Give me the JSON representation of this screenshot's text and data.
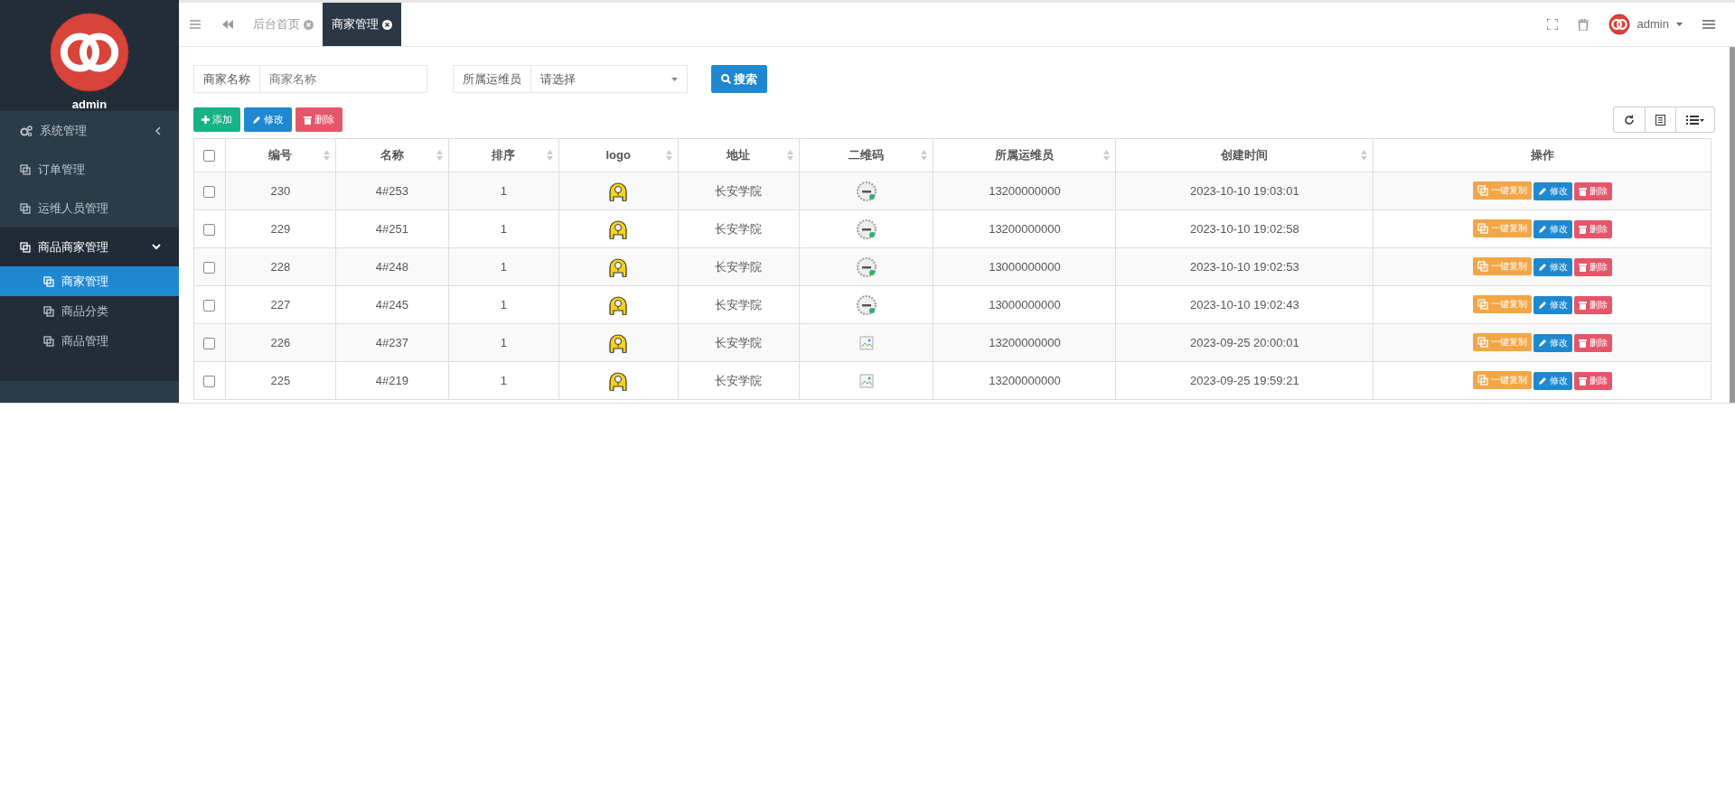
{
  "sidebar": {
    "user": "admin",
    "items": [
      {
        "label": "系统管理",
        "kind": "settings",
        "expanded": false
      },
      {
        "label": "订单管理",
        "kind": "page"
      },
      {
        "label": "运维人员管理",
        "kind": "page"
      },
      {
        "label": "商品商家管理",
        "kind": "page",
        "expanded": true,
        "children": [
          {
            "label": "商家管理",
            "selected": true
          },
          {
            "label": "商品分类",
            "selected": false
          },
          {
            "label": "商品管理",
            "selected": false
          }
        ]
      }
    ]
  },
  "tabs": [
    {
      "label": "后台首页",
      "selected": false
    },
    {
      "label": "商家管理",
      "selected": true
    }
  ],
  "header": {
    "user": "admin"
  },
  "filters": [
    {
      "kind": "text",
      "label": "商家名称",
      "placeholder": "商家名称"
    },
    {
      "kind": "select",
      "label": "所属运维员",
      "placeholder": "请选择"
    }
  ],
  "search_button": "搜索",
  "toolbar": [
    {
      "kind": "add",
      "label": "添加"
    },
    {
      "kind": "edit",
      "label": "修改"
    },
    {
      "kind": "delete",
      "label": "删除"
    }
  ],
  "table": {
    "select_all": {
      "checked": false
    },
    "columns": [
      {
        "label": "编号",
        "sortable": true
      },
      {
        "label": "名称",
        "sortable": true
      },
      {
        "label": "排序",
        "sortable": true
      },
      {
        "label": "logo",
        "sortable": true
      },
      {
        "label": "地址",
        "sortable": true
      },
      {
        "label": "二维码",
        "sortable": true
      },
      {
        "label": "所属运维员",
        "sortable": true
      },
      {
        "label": "创建时间",
        "sortable": true
      },
      {
        "label": "操作",
        "sortable": false
      }
    ],
    "rows": [
      {
        "checked": false,
        "id": "230",
        "name": "4#253",
        "order": "1",
        "address": "长安学院",
        "qr": {
          "kind": "image"
        },
        "staff": "13200000000",
        "created": "2023-10-10 19:03:01",
        "actions": [
          {
            "kind": "copy",
            "label": "一键复制"
          },
          {
            "kind": "edit",
            "label": "修改"
          },
          {
            "kind": "delete",
            "label": "删除"
          }
        ]
      },
      {
        "checked": false,
        "id": "229",
        "name": "4#251",
        "order": "1",
        "address": "长安学院",
        "qr": {
          "kind": "image"
        },
        "staff": "13200000000",
        "created": "2023-10-10 19:02:58",
        "actions": [
          {
            "kind": "copy",
            "label": "一键复制"
          },
          {
            "kind": "edit",
            "label": "修改"
          },
          {
            "kind": "delete",
            "label": "删除"
          }
        ]
      },
      {
        "checked": false,
        "id": "228",
        "name": "4#248",
        "order": "1",
        "address": "长安学院",
        "qr": {
          "kind": "image"
        },
        "staff": "13000000000",
        "created": "2023-10-10 19:02:53",
        "actions": [
          {
            "kind": "copy",
            "label": "一键复制"
          },
          {
            "kind": "edit",
            "label": "修改"
          },
          {
            "kind": "delete",
            "label": "删除"
          }
        ]
      },
      {
        "checked": false,
        "id": "227",
        "name": "4#245",
        "order": "1",
        "address": "长安学院",
        "qr": {
          "kind": "image"
        },
        "staff": "13000000000",
        "created": "2023-10-10 19:02:43",
        "actions": [
          {
            "kind": "copy",
            "label": "一键复制"
          },
          {
            "kind": "edit",
            "label": "修改"
          },
          {
            "kind": "delete",
            "label": "删除"
          }
        ]
      },
      {
        "checked": false,
        "id": "226",
        "name": "4#237",
        "order": "1",
        "address": "长安学院",
        "qr": {
          "kind": "broken"
        },
        "staff": "13200000000",
        "created": "2023-09-25 20:00:01",
        "actions": [
          {
            "kind": "copy",
            "label": "一键复制"
          },
          {
            "kind": "edit",
            "label": "修改"
          },
          {
            "kind": "delete",
            "label": "删除"
          }
        ]
      },
      {
        "checked": false,
        "id": "225",
        "name": "4#219",
        "order": "1",
        "address": "长安学院",
        "qr": {
          "kind": "broken"
        },
        "staff": "13200000000",
        "created": "2023-09-25 19:59:21",
        "actions": [
          {
            "kind": "copy",
            "label": "一键复制"
          },
          {
            "kind": "edit",
            "label": "修改"
          },
          {
            "kind": "delete",
            "label": "删除"
          }
        ]
      }
    ]
  }
}
